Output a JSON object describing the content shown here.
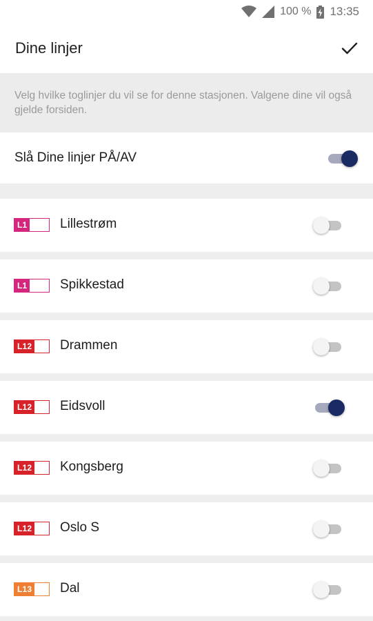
{
  "status_bar": {
    "battery": "100 %",
    "time": "13:35",
    "icons": [
      "wifi-icon",
      "signal-icon",
      "battery-charging-icon"
    ]
  },
  "header": {
    "title": "Dine linjer",
    "confirm_icon": "check-icon"
  },
  "info_text": "Velg hvilke toglinjer du vil se for denne stasjonen. Valgene dine vil også gjelde forsiden.",
  "master_toggle": {
    "label": "Slå Dine linjer PÅ/AV",
    "on": true
  },
  "lines": [
    {
      "code": "L1",
      "name": "Lillestrøm",
      "color": "#d4267d",
      "on": false
    },
    {
      "code": "L1",
      "name": "Spikkestad",
      "color": "#d4267d",
      "on": false
    },
    {
      "code": "L12",
      "name": "Drammen",
      "color": "#d72229",
      "on": false
    },
    {
      "code": "L12",
      "name": "Eidsvoll",
      "color": "#d72229",
      "on": true
    },
    {
      "code": "L12",
      "name": "Kongsberg",
      "color": "#d72229",
      "on": false
    },
    {
      "code": "L12",
      "name": "Oslo S",
      "color": "#d72229",
      "on": false
    },
    {
      "code": "L13",
      "name": "Dal",
      "color": "#ef7f32",
      "on": false
    }
  ],
  "colors": {
    "toggle_on": "#1a2a63",
    "toggle_off": "#c4c4c4"
  }
}
